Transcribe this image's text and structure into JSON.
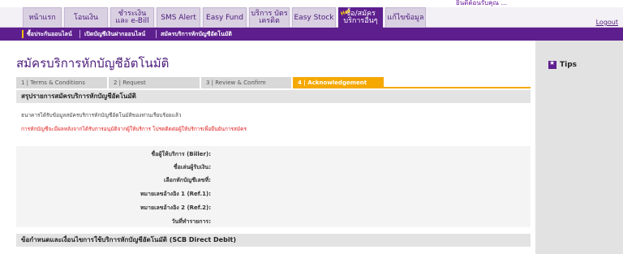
{
  "header": {
    "welcome_text": "ยินดีต้อนรับคุณ ...",
    "logout_label": "Logout"
  },
  "nav": {
    "tabs": [
      {
        "label": "หน้าแรก"
      },
      {
        "label": "โอนเงิน"
      },
      {
        "label": "ชำระเงิน และ e-Bill"
      },
      {
        "label": "SMS Alert"
      },
      {
        "label": "Easy Fund"
      },
      {
        "label": "บริการ บัตรเครดิต"
      },
      {
        "label": "Easy Stock"
      },
      {
        "label": "ซื้อ/สมัคร บริการอื่นๆ",
        "badge": "Hot"
      },
      {
        "label": "แก้ไขข้อมูล"
      }
    ]
  },
  "subnav": {
    "items": [
      {
        "label": "ซื้อประกันออนไลน์"
      },
      {
        "label": "เปิดบัญชีเงินฝากออนไลน์"
      },
      {
        "label": "สมัครบริการหักบัญชีอัตโนมัติ"
      }
    ]
  },
  "page": {
    "title": "สมัครบริการหักบัญชีอัตโนมัติ",
    "steps": [
      {
        "label": "1 | Terms & Conditions"
      },
      {
        "label": "2 | Request"
      },
      {
        "label": "3 | Review & Confirm"
      },
      {
        "label": "4 | Acknowledgement"
      }
    ],
    "summary_header": "สรุปรายการสมัครบริการหักบัญชีอัตโนมัติ",
    "message": "ธนาคารได้รับข้อมูลสมัครบริการหักบัญชีอัตโนมัติของท่านเรียบร้อยแล้ว",
    "warning": "การหักบัญชีจะมีผลหลังจากได้รับการอนุมัติจากผู้ให้บริการ โปรดติดต่อผู้ให้บริการเพื่อยืนยันการสมัคร",
    "details": [
      {
        "label": "ชื่อผู้ให้บริการ (Biller):"
      },
      {
        "label": "ชื่อเล่นผู้รับเงิน:"
      },
      {
        "label": "เลือกหักบัญชีเลขที่:"
      },
      {
        "label": "หมายเลขอ้างอิง 1 (Ref.1):"
      },
      {
        "label": "หมายเลขอ้างอิง 2 (Ref.2):"
      },
      {
        "label": "วันที่ทำรายการ:"
      }
    ],
    "terms_header": "ข้อกำหนดและเงื่อนไขการใช้บริการหักบัญชีอัตโนมัติ (SCB Direct Debit)"
  },
  "sidebar": {
    "tips_label": "Tips"
  },
  "colors": {
    "brand_purple": "#5e1f8e",
    "step_active": "#f5a800",
    "warning_red": "#e02020"
  }
}
